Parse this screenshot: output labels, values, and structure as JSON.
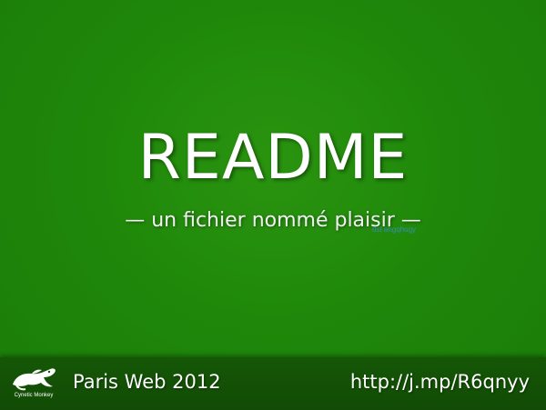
{
  "slide": {
    "title": "README",
    "subtitle": "— un fichier nommé plaisir —",
    "watermark": "dsf ahgqhugy"
  },
  "footer": {
    "logo_icon": "cynetic-monkey-logo-icon",
    "logo_text": "Cynetic Monkey",
    "event": "Paris Web 2012",
    "link": "http://j.mp/R6qnyy"
  },
  "colors": {
    "background": "#1f880a",
    "footer": "#155706",
    "text": "#ffffff",
    "watermark": "#3f8fd6"
  }
}
